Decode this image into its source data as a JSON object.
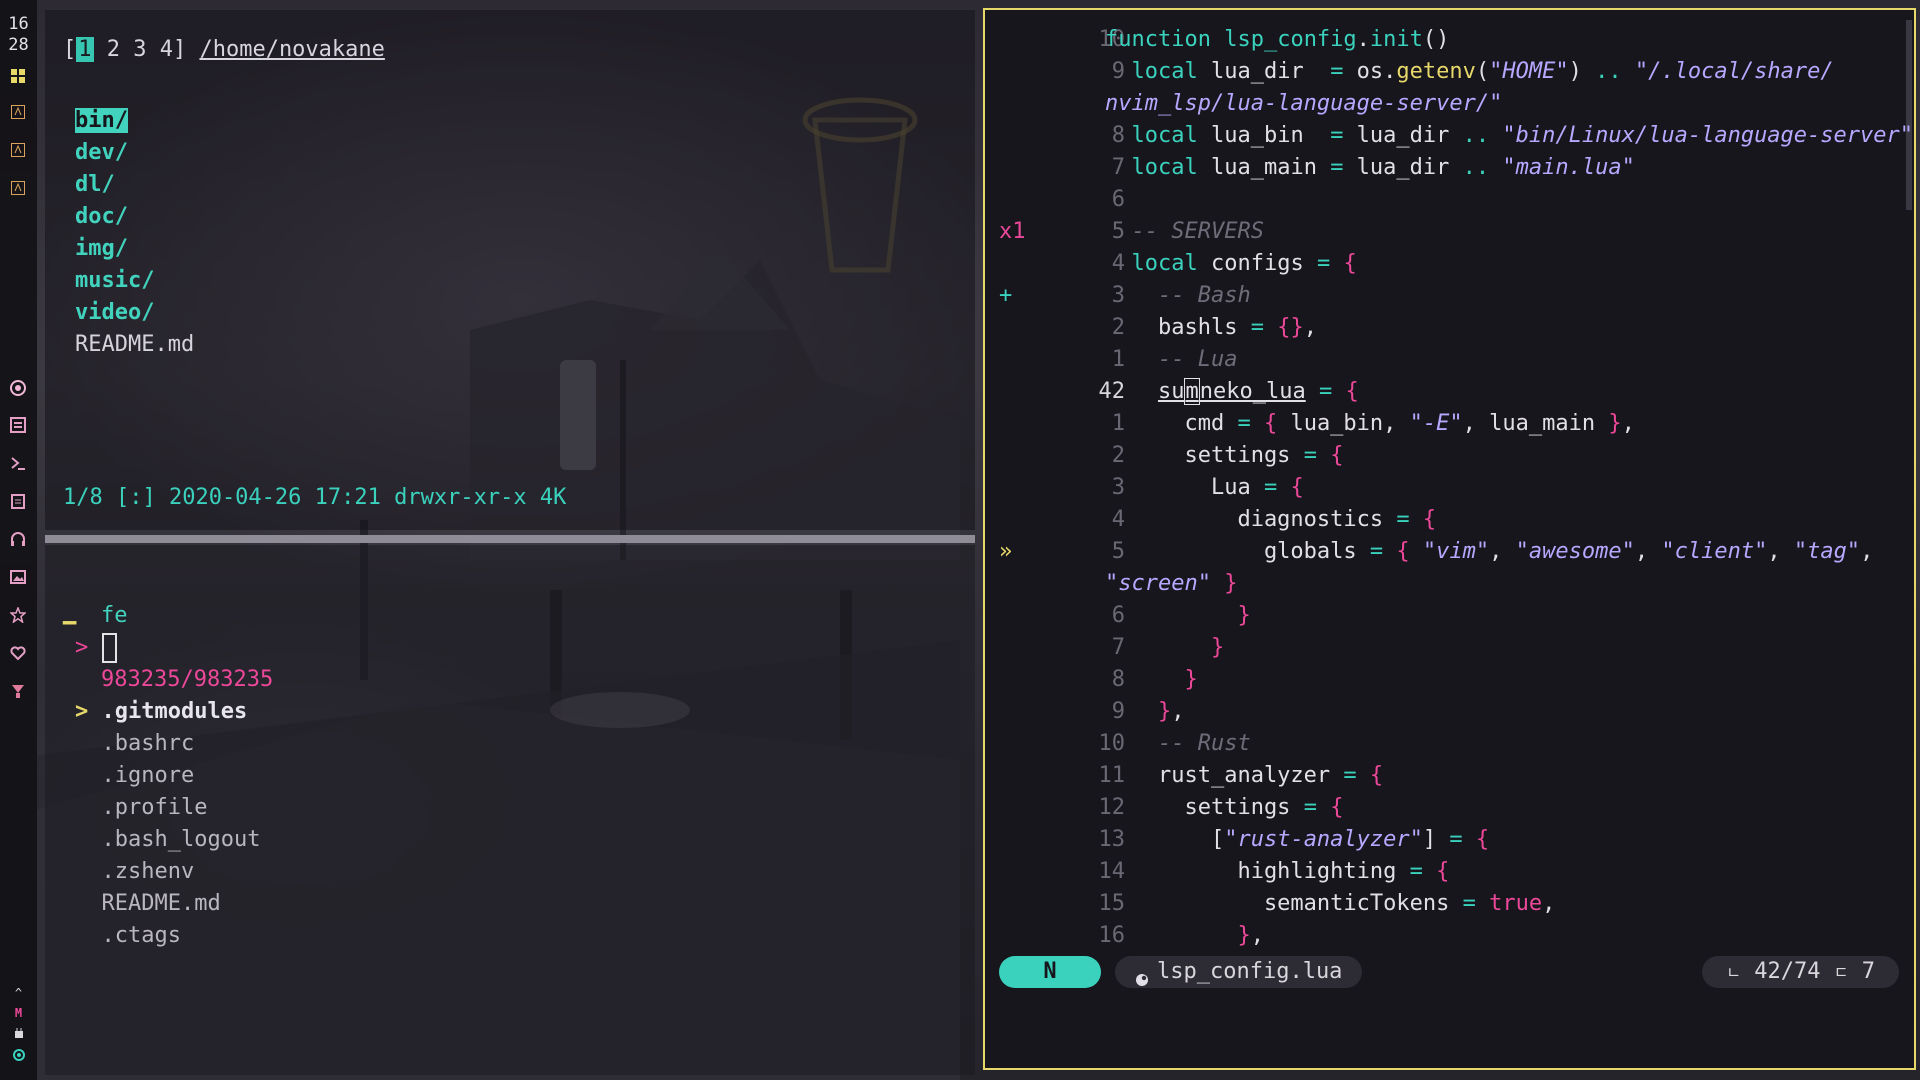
{
  "sidebar": {
    "clock_hour": "16",
    "clock_min": "28",
    "icons": [
      "layout-icon",
      "terminal-app-icon",
      "terminal-app-icon",
      "terminal-app-icon",
      "record-icon",
      "file-list-icon",
      "shell-icon",
      "notes-icon",
      "headphones-icon",
      "image-icon",
      "star-icon",
      "heart-icon",
      "download-icon"
    ],
    "bottom": {
      "up": "^",
      "mark": "M",
      "battery_icon": "plug-icon",
      "dot_icon": "circle-icon"
    }
  },
  "lf": {
    "tabs_open": "[",
    "tab1": "1",
    "tabs_rest": " 2 3 4]",
    "cwd": "/home/novakane",
    "entries": [
      {
        "name": "bin/",
        "type": "dir",
        "selected": true
      },
      {
        "name": "dev/",
        "type": "dir"
      },
      {
        "name": "dl/",
        "type": "dir"
      },
      {
        "name": "doc/",
        "type": "dir"
      },
      {
        "name": "img/",
        "type": "dir"
      },
      {
        "name": "music/",
        "type": "dir"
      },
      {
        "name": "video/",
        "type": "dir"
      },
      {
        "name": "README.md",
        "type": "file"
      }
    ],
    "status": "1/8 [:] 2020-04-26 17:21 drwxr-xr-x 4K"
  },
  "fzf": {
    "label": "fe",
    "prompt": ">",
    "count": "983235/983235",
    "pointer": ">",
    "items": [
      ".gitmodules",
      ".bashrc",
      ".ignore",
      ".profile",
      ".bash_logout",
      ".zshenv",
      "README.md",
      ".ctags"
    ]
  },
  "nvim": {
    "code": [
      {
        "sign": "",
        "num": "10",
        "html": "<span class='kw'>function</span> <span class='kw'>lsp_config</span>.<span class='kw'>init</span>()"
      },
      {
        "sign": "",
        "num": "9",
        "html": "  <span class='kw'>local</span> lua_dir  <span class='op'>=</span> os.<span class='fn'>getenv</span>(<span class='str'>\"HOME\"</span>) <span class='op'>..</span> <span class='str'>\"/.local/share/</span>"
      },
      {
        "sign": "",
        "num": "",
        "html": "<span class='str'>nvim_lsp/lua-language-server/\"</span>"
      },
      {
        "sign": "",
        "num": "8",
        "html": "  <span class='kw'>local</span> lua_bin  <span class='op'>=</span> lua_dir <span class='op'>..</span> <span class='str'>\"bin/Linux/lua-language-server\"</span>"
      },
      {
        "sign": "",
        "num": "7",
        "html": "  <span class='kw'>local</span> lua_main <span class='op'>=</span> lua_dir <span class='op'>..</span> <span class='str'>\"main.lua\"</span>"
      },
      {
        "sign": "",
        "num": "6",
        "html": ""
      },
      {
        "sign": "x1",
        "signcls": "sign-err",
        "num": "5",
        "html": "  <span class='cmt'>-- SERVERS</span>"
      },
      {
        "sign": "",
        "num": "4",
        "html": "  <span class='kw'>local</span> configs <span class='op'>=</span> <span class='brace'>{</span>"
      },
      {
        "sign": "+",
        "signcls": "sign-add",
        "num": "3",
        "html": "    <span class='cmt'>-- Bash</span>"
      },
      {
        "sign": "",
        "num": "2",
        "html": "    bashls <span class='op'>=</span> <span class='brace'>{}</span>,"
      },
      {
        "sign": "",
        "num": "1",
        "html": "    <span class='cmt'>-- Lua</span>"
      },
      {
        "sign": "",
        "num": "42",
        "cur": true,
        "html": "    <span class='ul'>su<span class='vcursor'>m</span>neko_lua</span> <span class='op'>=</span> <span class='brace'>{</span>"
      },
      {
        "sign": "",
        "num": "1",
        "html": "      cmd <span class='op'>=</span> <span class='brace'>{</span> lua_bin, <span class='str'>\"-E\"</span>, lua_main <span class='brace'>}</span>,"
      },
      {
        "sign": "",
        "num": "2",
        "html": "      settings <span class='op'>=</span> <span class='brace'>{</span>"
      },
      {
        "sign": "",
        "num": "3",
        "html": "        Lua <span class='op'>=</span> <span class='brace'>{</span>"
      },
      {
        "sign": "",
        "num": "4",
        "html": "          diagnostics <span class='op'>=</span> <span class='brace'>{</span>"
      },
      {
        "sign": "»",
        "signcls": "sign-warn",
        "num": "5",
        "html": "            globals <span class='op'>=</span> <span class='brace'>{</span> <span class='str'>\"vim\"</span>, <span class='str'>\"awesome\"</span>, <span class='str'>\"client\"</span>, <span class='str'>\"tag\"</span>,"
      },
      {
        "sign": "",
        "num": "",
        "html": "<span class='str'>\"screen\"</span> <span class='brace'>}</span>"
      },
      {
        "sign": "",
        "num": "6",
        "html": "          <span class='brace'>}</span>"
      },
      {
        "sign": "",
        "num": "7",
        "html": "        <span class='brace'>}</span>"
      },
      {
        "sign": "",
        "num": "8",
        "html": "      <span class='brace'>}</span>"
      },
      {
        "sign": "",
        "num": "9",
        "html": "    <span class='brace'>}</span>,"
      },
      {
        "sign": "",
        "num": "10",
        "html": "    <span class='cmt'>-- Rust</span>"
      },
      {
        "sign": "",
        "num": "11",
        "html": "    rust_analyzer <span class='op'>=</span> <span class='brace'>{</span>"
      },
      {
        "sign": "",
        "num": "12",
        "html": "      settings <span class='op'>=</span> <span class='brace'>{</span>"
      },
      {
        "sign": "",
        "num": "13",
        "html": "        [<span class='str'>\"rust-analyzer\"</span>] <span class='op'>=</span> <span class='brace'>{</span>"
      },
      {
        "sign": "",
        "num": "14",
        "html": "          highlighting <span class='op'>=</span> <span class='brace'>{</span>"
      },
      {
        "sign": "",
        "num": "15",
        "html": "            semanticTokens <span class='op'>=</span> <span class='bool'>true</span>,"
      },
      {
        "sign": "",
        "num": "16",
        "html": "          <span class='brace'>}</span>,"
      }
    ],
    "status": {
      "mode": "N",
      "filename": "lsp_config.lua",
      "file_icon": "lua-file-icon",
      "position": "42/74",
      "column": "7",
      "line_icon": "line-number-icon",
      "col_icon": "column-number-icon"
    }
  },
  "colors": {
    "accent_teal": "#3ad1bd",
    "accent_pink": "#ec4899",
    "accent_yellow": "#e7d86a",
    "string_purple": "#b7a7ff",
    "background": "#17161c"
  }
}
